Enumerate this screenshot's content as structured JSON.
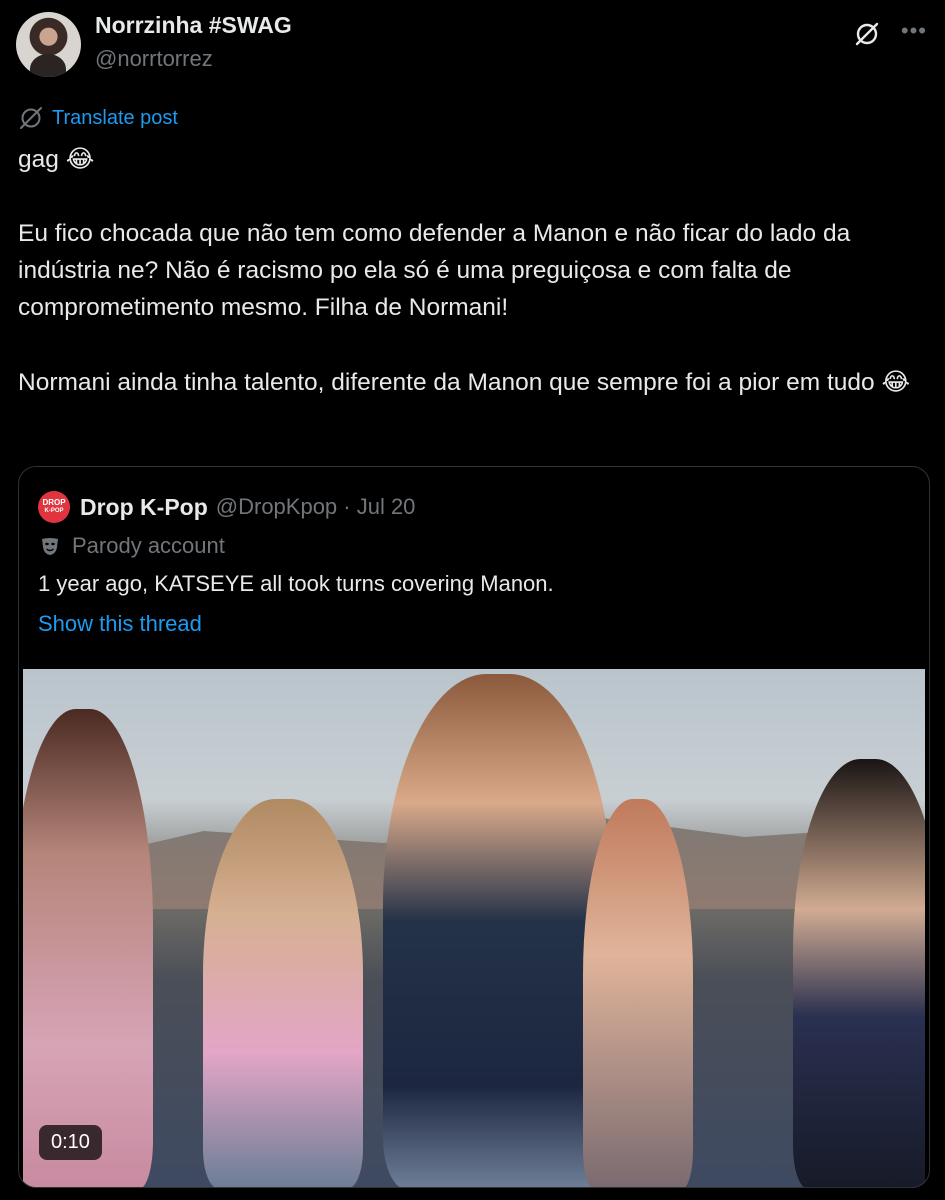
{
  "author": {
    "name": "Norrzinha #SWAG",
    "handle": "@norrtorrez"
  },
  "icons": {
    "grok": "grok-icon",
    "more": "more-icon",
    "translate": "translate-icon",
    "parody": "mask-icon"
  },
  "translate_label": "Translate post",
  "body": {
    "line1": "gag",
    "line1_emoji": "😂",
    "para2": "Eu fico chocada que não tem como defender a Manon e não ficar do lado da indústria ne? Não é racismo po ela só é uma preguiçosa e com falta de comprometimento mesmo. Filha de Normani!",
    "para3": "Normani ainda tinha talento, diferente da Manon que sempre foi a pior em tudo",
    "para3_emoji": "😂"
  },
  "quote": {
    "name": "Drop K-Pop",
    "handle_date": "@DropKpop · Jul 20",
    "logo_text_top": "DROP",
    "logo_text_bottom": "K-POP",
    "parody_label": "Parody account",
    "text": "1 year ago, KATSEYE all took turns covering Manon.",
    "thread_link": "Show this thread",
    "video_duration": "0:10"
  },
  "colors": {
    "background": "#000000",
    "text": "#e7e9ea",
    "muted": "#71767b",
    "link": "#1d9bf0",
    "border": "#2f3336"
  }
}
